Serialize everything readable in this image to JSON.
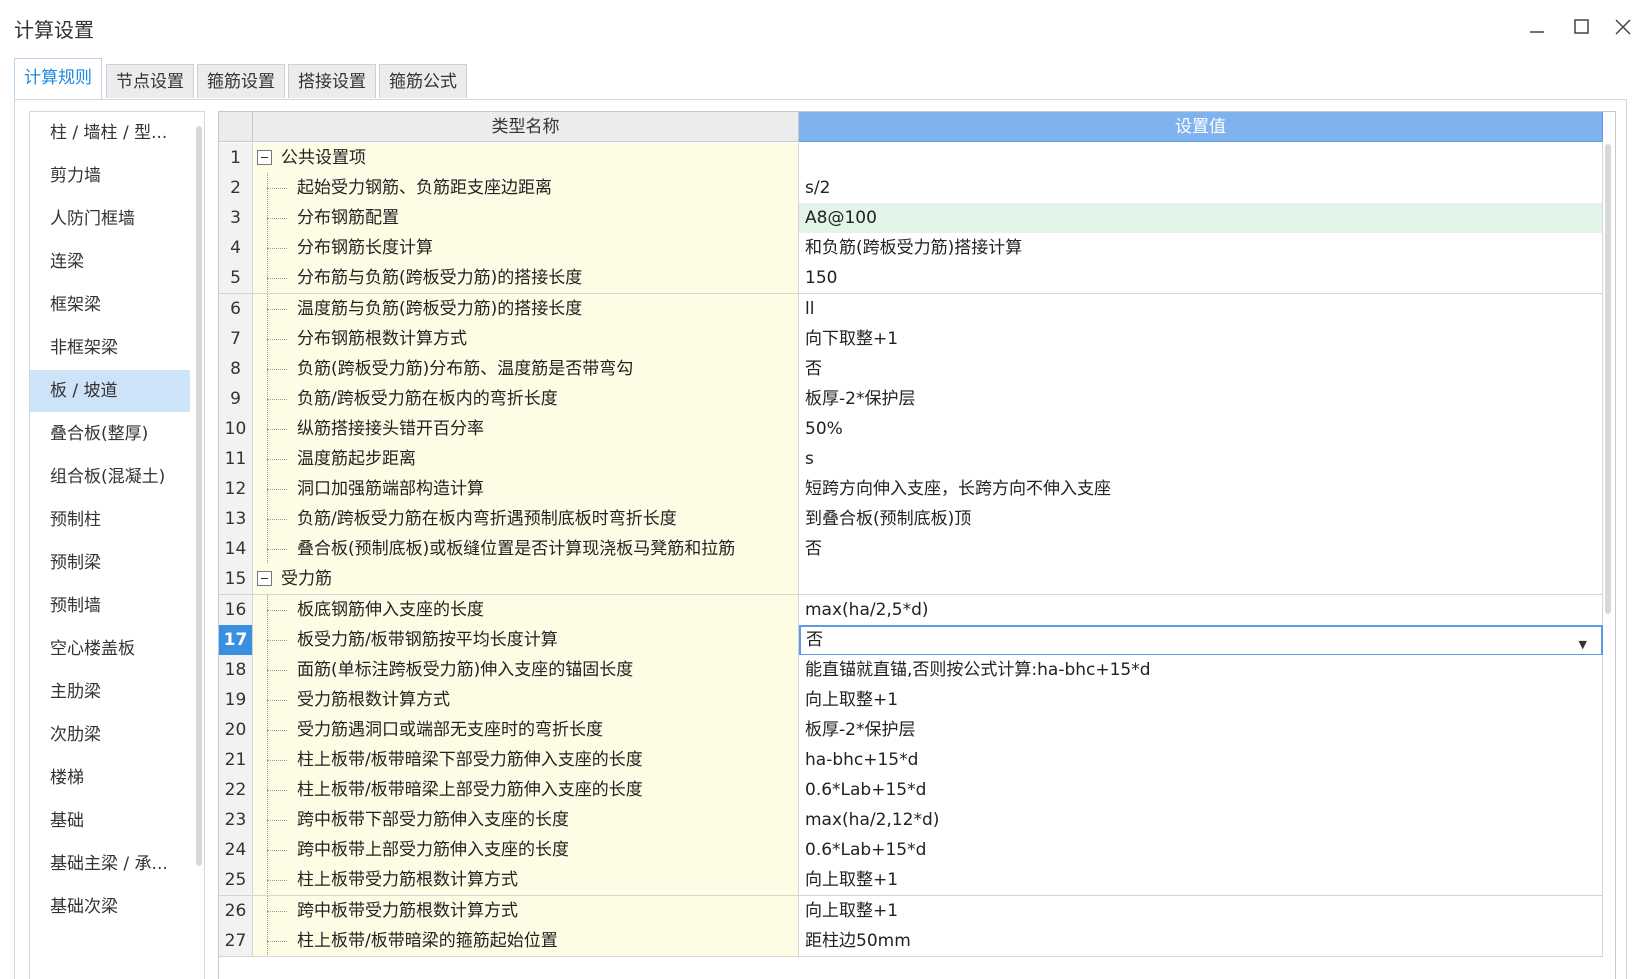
{
  "window": {
    "title": "计算设置"
  },
  "tabs": [
    {
      "label": "计算规则",
      "active": true
    },
    {
      "label": "节点设置",
      "active": false
    },
    {
      "label": "箍筋设置",
      "active": false
    },
    {
      "label": "搭接设置",
      "active": false
    },
    {
      "label": "箍筋公式",
      "active": false
    }
  ],
  "sidebar": {
    "items": [
      {
        "label": "柱 / 墙柱 / 型..."
      },
      {
        "label": "剪力墙"
      },
      {
        "label": "人防门框墙"
      },
      {
        "label": "连梁"
      },
      {
        "label": "框架梁"
      },
      {
        "label": "非框架梁"
      },
      {
        "label": "板 / 坡道",
        "selected": true
      },
      {
        "label": "叠合板(整厚)"
      },
      {
        "label": "组合板(混凝土)"
      },
      {
        "label": "预制柱"
      },
      {
        "label": "预制梁"
      },
      {
        "label": "预制墙"
      },
      {
        "label": "空心楼盖板"
      },
      {
        "label": "主肋梁"
      },
      {
        "label": "次肋梁"
      },
      {
        "label": "楼梯"
      },
      {
        "label": "基础"
      },
      {
        "label": "基础主梁 / 承..."
      },
      {
        "label": "基础次梁"
      }
    ]
  },
  "grid": {
    "columns": {
      "name": "类型名称",
      "value": "设置值"
    },
    "selected_row": "17",
    "rows": [
      {
        "num": "1",
        "name": "公共设置项",
        "value": "",
        "group": true
      },
      {
        "num": "2",
        "name": "起始受力钢筋、负筋距支座边距离",
        "value": "s/2"
      },
      {
        "num": "3",
        "name": "分布钢筋配置",
        "value": "A8@100",
        "highlight": true
      },
      {
        "num": "4",
        "name": "分布钢筋长度计算",
        "value": "和负筋(跨板受力筋)搭接计算"
      },
      {
        "num": "5",
        "name": "分布筋与负筋(跨板受力筋)的搭接长度",
        "value": "150"
      },
      {
        "num": "6",
        "name": "温度筋与负筋(跨板受力筋)的搭接长度",
        "value": "ll"
      },
      {
        "num": "7",
        "name": "分布钢筋根数计算方式",
        "value": "向下取整+1"
      },
      {
        "num": "8",
        "name": "负筋(跨板受力筋)分布筋、温度筋是否带弯勾",
        "value": "否"
      },
      {
        "num": "9",
        "name": "负筋/跨板受力筋在板内的弯折长度",
        "value": "板厚-2*保护层"
      },
      {
        "num": "10",
        "name": "纵筋搭接接头错开百分率",
        "value": "50%"
      },
      {
        "num": "11",
        "name": "温度筋起步距离",
        "value": "s"
      },
      {
        "num": "12",
        "name": "洞口加强筋端部构造计算",
        "value": "短跨方向伸入支座，长跨方向不伸入支座"
      },
      {
        "num": "13",
        "name": "负筋/跨板受力筋在板内弯折遇预制底板时弯折长度",
        "value": "到叠合板(预制底板)顶"
      },
      {
        "num": "14",
        "name": "叠合板(预制底板)或板缝位置是否计算现浇板马凳筋和拉筋",
        "value": "否"
      },
      {
        "num": "15",
        "name": "受力筋",
        "value": "",
        "group": true
      },
      {
        "num": "16",
        "name": "板底钢筋伸入支座的长度",
        "value": "max(ha/2,5*d)"
      },
      {
        "num": "17",
        "name": "板受力筋/板带钢筋按平均长度计算",
        "value": "否",
        "editing": true
      },
      {
        "num": "18",
        "name": "面筋(单标注跨板受力筋)伸入支座的锚固长度",
        "value": "能直锚就直锚,否则按公式计算:ha-bhc+15*d"
      },
      {
        "num": "19",
        "name": "受力筋根数计算方式",
        "value": "向上取整+1"
      },
      {
        "num": "20",
        "name": "受力筋遇洞口或端部无支座时的弯折长度",
        "value": "板厚-2*保护层"
      },
      {
        "num": "21",
        "name": "柱上板带/板带暗梁下部受力筋伸入支座的长度",
        "value": "ha-bhc+15*d"
      },
      {
        "num": "22",
        "name": "柱上板带/板带暗梁上部受力筋伸入支座的长度",
        "value": "0.6*Lab+15*d"
      },
      {
        "num": "23",
        "name": "跨中板带下部受力筋伸入支座的长度",
        "value": "max(ha/2,12*d)"
      },
      {
        "num": "24",
        "name": "跨中板带上部受力筋伸入支座的长度",
        "value": "0.6*Lab+15*d"
      },
      {
        "num": "25",
        "name": "柱上板带受力筋根数计算方式",
        "value": "向上取整+1"
      },
      {
        "num": "26",
        "name": "跨中板带受力筋根数计算方式",
        "value": "向上取整+1"
      },
      {
        "num": "27",
        "name": "柱上板带/板带暗梁的箍筋起始位置",
        "value": "距柱边50mm"
      }
    ]
  }
}
